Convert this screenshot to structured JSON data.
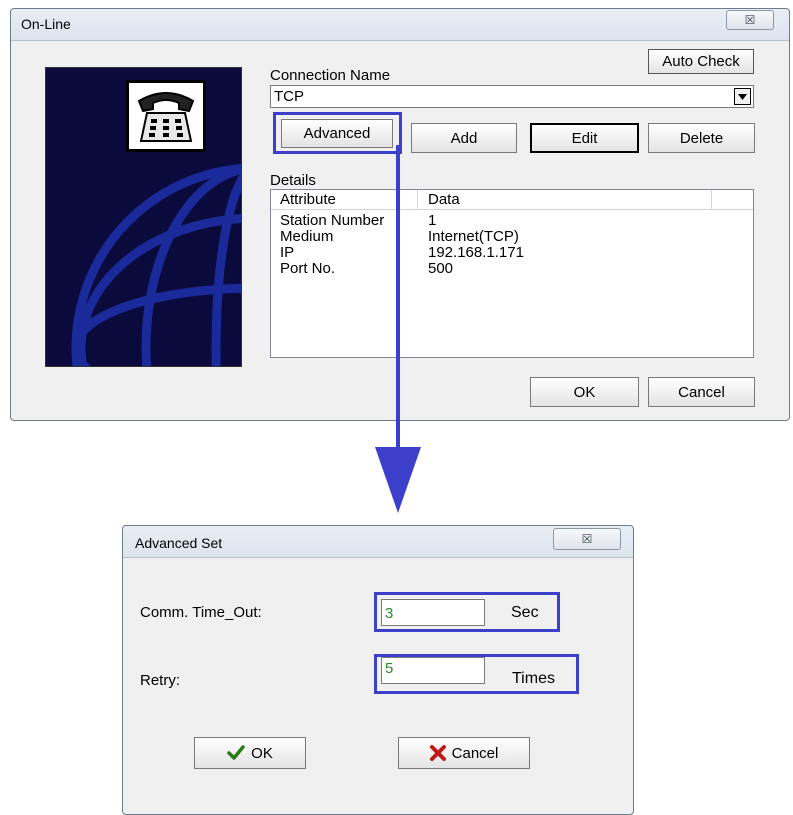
{
  "online": {
    "title": "On-Line",
    "close_symbol": "☒",
    "auto_check_label": "Auto Check",
    "connection_name_label": "Connection Name",
    "connection_value": "TCP",
    "buttons": {
      "advanced": "Advanced",
      "add": "Add",
      "edit": "Edit",
      "delete": "Delete",
      "ok": "OK",
      "cancel": "Cancel"
    },
    "details_label": "Details",
    "columns": [
      "Attribute",
      "Data"
    ],
    "rows": [
      {
        "attribute": "Station Number",
        "data": "1"
      },
      {
        "attribute": "Medium",
        "data": "Internet(TCP)"
      },
      {
        "attribute": "IP",
        "data": "192.168.1.171"
      },
      {
        "attribute": "Port No.",
        "data": "500"
      }
    ]
  },
  "advanced": {
    "title": "Advanced Set",
    "close_symbol": "☒",
    "timeout_label": "Comm. Time_Out:",
    "timeout_value": "3",
    "timeout_unit": "Sec",
    "retry_label": "Retry:",
    "retry_value": "5",
    "retry_unit": "Times",
    "ok_label": "OK",
    "cancel_label": "Cancel"
  },
  "colors": {
    "highlight": "#3b3fc9",
    "arrow": "#3b3fc9",
    "banner_bg": "#0a0a3c",
    "banner_globe": "#1a2a9a",
    "input_text": "#2a8a2a"
  },
  "icons": [
    "telephone-icon",
    "globe-graphic",
    "dropdown-arrow-icon",
    "checkmark-icon",
    "x-cancel-icon",
    "down-arrow-annotation"
  ]
}
